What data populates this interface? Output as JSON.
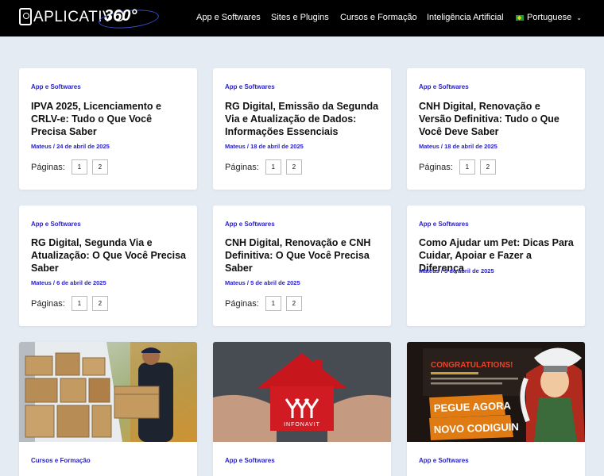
{
  "site": {
    "logo_text": "APLICATIVO",
    "logo_num": "360°"
  },
  "nav": {
    "items": [
      "App e Softwares",
      "Sites e Plugins",
      "Cursos e Formação",
      "Inteligência Artificial"
    ],
    "language": "Portuguese"
  },
  "pagination_label": "Páginas:",
  "posts": [
    {
      "category": "App e Softwares",
      "title": "IPVA 2025, Licenciamento e CRLV-e: Tudo o Que Você Precisa Saber",
      "meta": "Mateus / 24 de abril de 2025",
      "pages": [
        "1",
        "2"
      ]
    },
    {
      "category": "App e Softwares",
      "title": "RG Digital, Emissão da Segunda Via e Atualização de Dados: Informações Essenciais",
      "meta": "Mateus / 18 de abril de 2025",
      "pages": [
        "1",
        "2"
      ]
    },
    {
      "category": "App e Softwares",
      "title": "CNH Digital, Renovação e Versão Definitiva: Tudo o Que Você Deve Saber",
      "meta": "Mateus / 18 de abril de 2025",
      "pages": [
        "1",
        "2"
      ]
    },
    {
      "category": "App e Softwares",
      "title": "RG Digital, Segunda Via e Atualização: O Que Você Precisa Saber",
      "meta": "Mateus / 6 de abril de 2025",
      "pages": [
        "1",
        "2"
      ]
    },
    {
      "category": "App e Softwares",
      "title": "CNH Digital, Renovação e CNH Definitiva: O Que Você Precisa Saber",
      "meta": "Mateus / 5 de abril de 2025",
      "pages": [
        "1",
        "2"
      ]
    },
    {
      "category": "App e Softwares",
      "title": "Como Ajudar um Pet: Dicas Para Cuidar, Apoiar e Fazer a Diferença",
      "meta": "Mateus / 5 de abril de 2025"
    },
    {
      "category": "Cursos e Formação"
    },
    {
      "category": "App e Softwares",
      "image_text": "INFONAVIT"
    },
    {
      "category": "App e Softwares",
      "image_heading": "CONGRATULATIONS!",
      "image_banner_1": "PEGUE AGORA",
      "image_banner_2": "NOVO CODIGUIN"
    }
  ],
  "colors": {
    "accent": "#2b22c8",
    "topbar": "#000000",
    "background": "#e4ebf3"
  }
}
